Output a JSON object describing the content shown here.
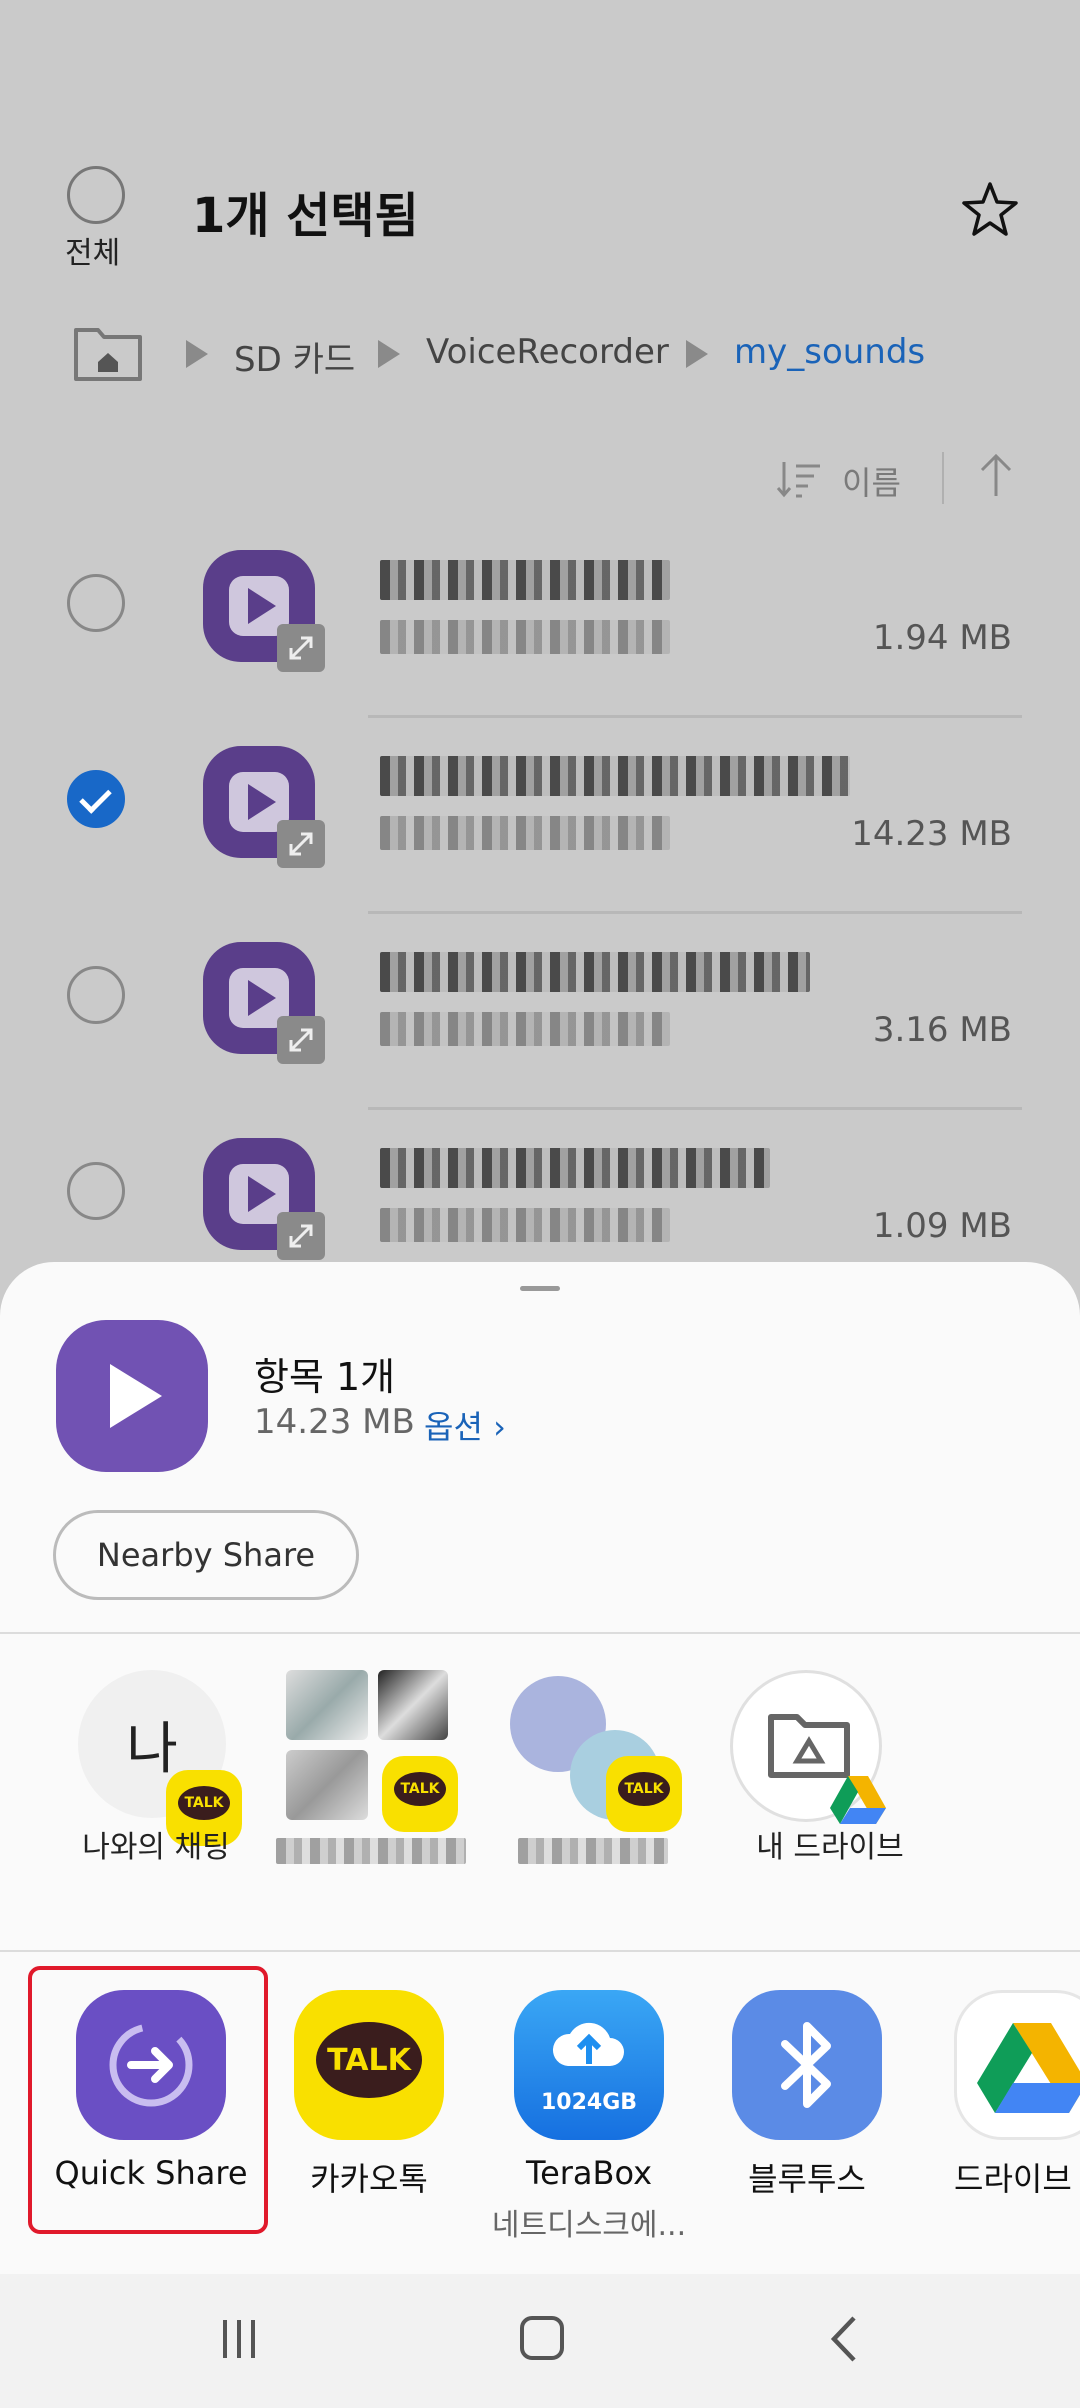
{
  "header": {
    "select_all_label": "전체",
    "title": "1개 선택됨"
  },
  "breadcrumb": {
    "items": [
      "SD 카드",
      "VoiceRecorder",
      "my_sounds"
    ]
  },
  "sort": {
    "label": "이름"
  },
  "files": [
    {
      "size": "1.94 MB",
      "checked": false
    },
    {
      "size": "14.23 MB",
      "checked": true
    },
    {
      "size": "3.16 MB",
      "checked": false
    },
    {
      "size": "1.09 MB",
      "checked": false
    }
  ],
  "share_sheet": {
    "item_title": "항목 1개",
    "item_size": "14.23 MB",
    "options_label": "옵션",
    "nearby_share_label": "Nearby Share",
    "contacts": [
      {
        "label": "나와의 채팅",
        "avatar_text": "나",
        "badge": "TALK"
      },
      {
        "label": "",
        "badge": "TALK"
      },
      {
        "label": "",
        "badge": "TALK"
      },
      {
        "label": "내 드라이브"
      },
      {
        "label": ""
      }
    ],
    "apps": [
      {
        "label": "Quick Share",
        "icon": "quick-share-icon",
        "color": "#6a4fc4"
      },
      {
        "label": "카카오톡",
        "icon": "kakaotalk-icon",
        "color": "#f9e000",
        "icon_text": "TALK"
      },
      {
        "label": "TeraBox",
        "sub": "네트디스크에...",
        "icon": "terabox-icon",
        "color": "#1e8ff0",
        "icon_text": "1024GB"
      },
      {
        "label": "블루투스",
        "icon": "bluetooth-icon",
        "color": "#5b8be6"
      },
      {
        "label": "드라이브",
        "icon": "google-drive-icon",
        "color": "#ffffff"
      }
    ]
  },
  "colors": {
    "accent": "#1a63b8",
    "highlight": "#e0192b"
  }
}
